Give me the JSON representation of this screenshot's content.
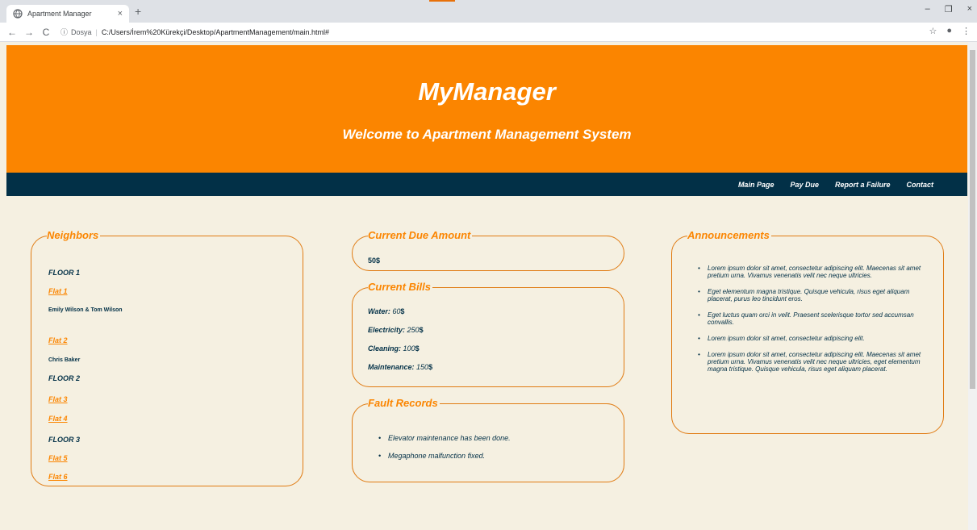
{
  "browser": {
    "tab_title": "Apartment Manager",
    "tab_close": "×",
    "new_tab": "+",
    "back": "←",
    "forward": "→",
    "reload": "C",
    "info": "ⓘ",
    "scheme_label": "Dosya",
    "separator": "|",
    "url": "C:/Users/İrem%20Kürekçi/Desktop/ApartmentManagement/main.html#",
    "bookmark": "☆",
    "profile": "●",
    "menu": "⋮",
    "minimize": "–",
    "maximize": "❐",
    "close": "×",
    "accent_color": "#e8710a"
  },
  "header": {
    "title": "MyManager",
    "subtitle": "Welcome to Apartment Management System",
    "background_color": "#fb8500"
  },
  "navbar": {
    "background_color": "#023047",
    "links": [
      "Main Page",
      "Pay Due",
      "Report a Failure",
      "Contact"
    ]
  },
  "neighbors": {
    "legend": "Neighbors",
    "floor1": "FLOOR 1",
    "flat1": "Flat 1",
    "flat1_residents": "Emily Wilson & Tom Wilson",
    "flat2": "Flat 2",
    "flat2_residents": "Chris Baker",
    "floor2": "FLOOR 2",
    "flat3": "Flat 3",
    "flat4": "Flat 4",
    "floor3": "FLOOR 3",
    "flat5": "Flat 5",
    "flat6": "Flat 6"
  },
  "due": {
    "legend": "Current Due Amount",
    "amount": "50$"
  },
  "bills": {
    "legend": "Current Bills",
    "items": [
      {
        "label": "Water:",
        "amount": "60",
        "unit": "$"
      },
      {
        "label": "Electricity:",
        "amount": "250",
        "unit": "$"
      },
      {
        "label": "Cleaning:",
        "amount": "100",
        "unit": "$"
      },
      {
        "label": "Maintenance:",
        "amount": "150",
        "unit": "$"
      }
    ]
  },
  "faults": {
    "legend": "Fault Records",
    "items": [
      "Elevator maintenance has been done.",
      "Megaphone malfunction fixed."
    ]
  },
  "announcements": {
    "legend": "Announcements",
    "items": [
      "Lorem ipsum dolor sit amet, consectetur adipiscing elit. Maecenas sit amet pretium urna. Vivamus venenatis velit nec neque ultricies.",
      "Eget elementum magna tristique. Quisque vehicula, risus eget aliquam placerat, purus leo tincidunt eros.",
      "Eget luctus quam orci in velit. Praesent scelerisque tortor sed accumsan convallis.",
      "Lorem ipsum dolor sit amet, consectetur adipiscing elit.",
      "Lorem ipsum dolor sit amet, consectetur adipiscing elit. Maecenas sit amet pretium urna. Vivamus venenatis velit nec neque ultricies, eget elementum magna tristique. Quisque vehicula, risus eget aliquam placerat."
    ]
  }
}
